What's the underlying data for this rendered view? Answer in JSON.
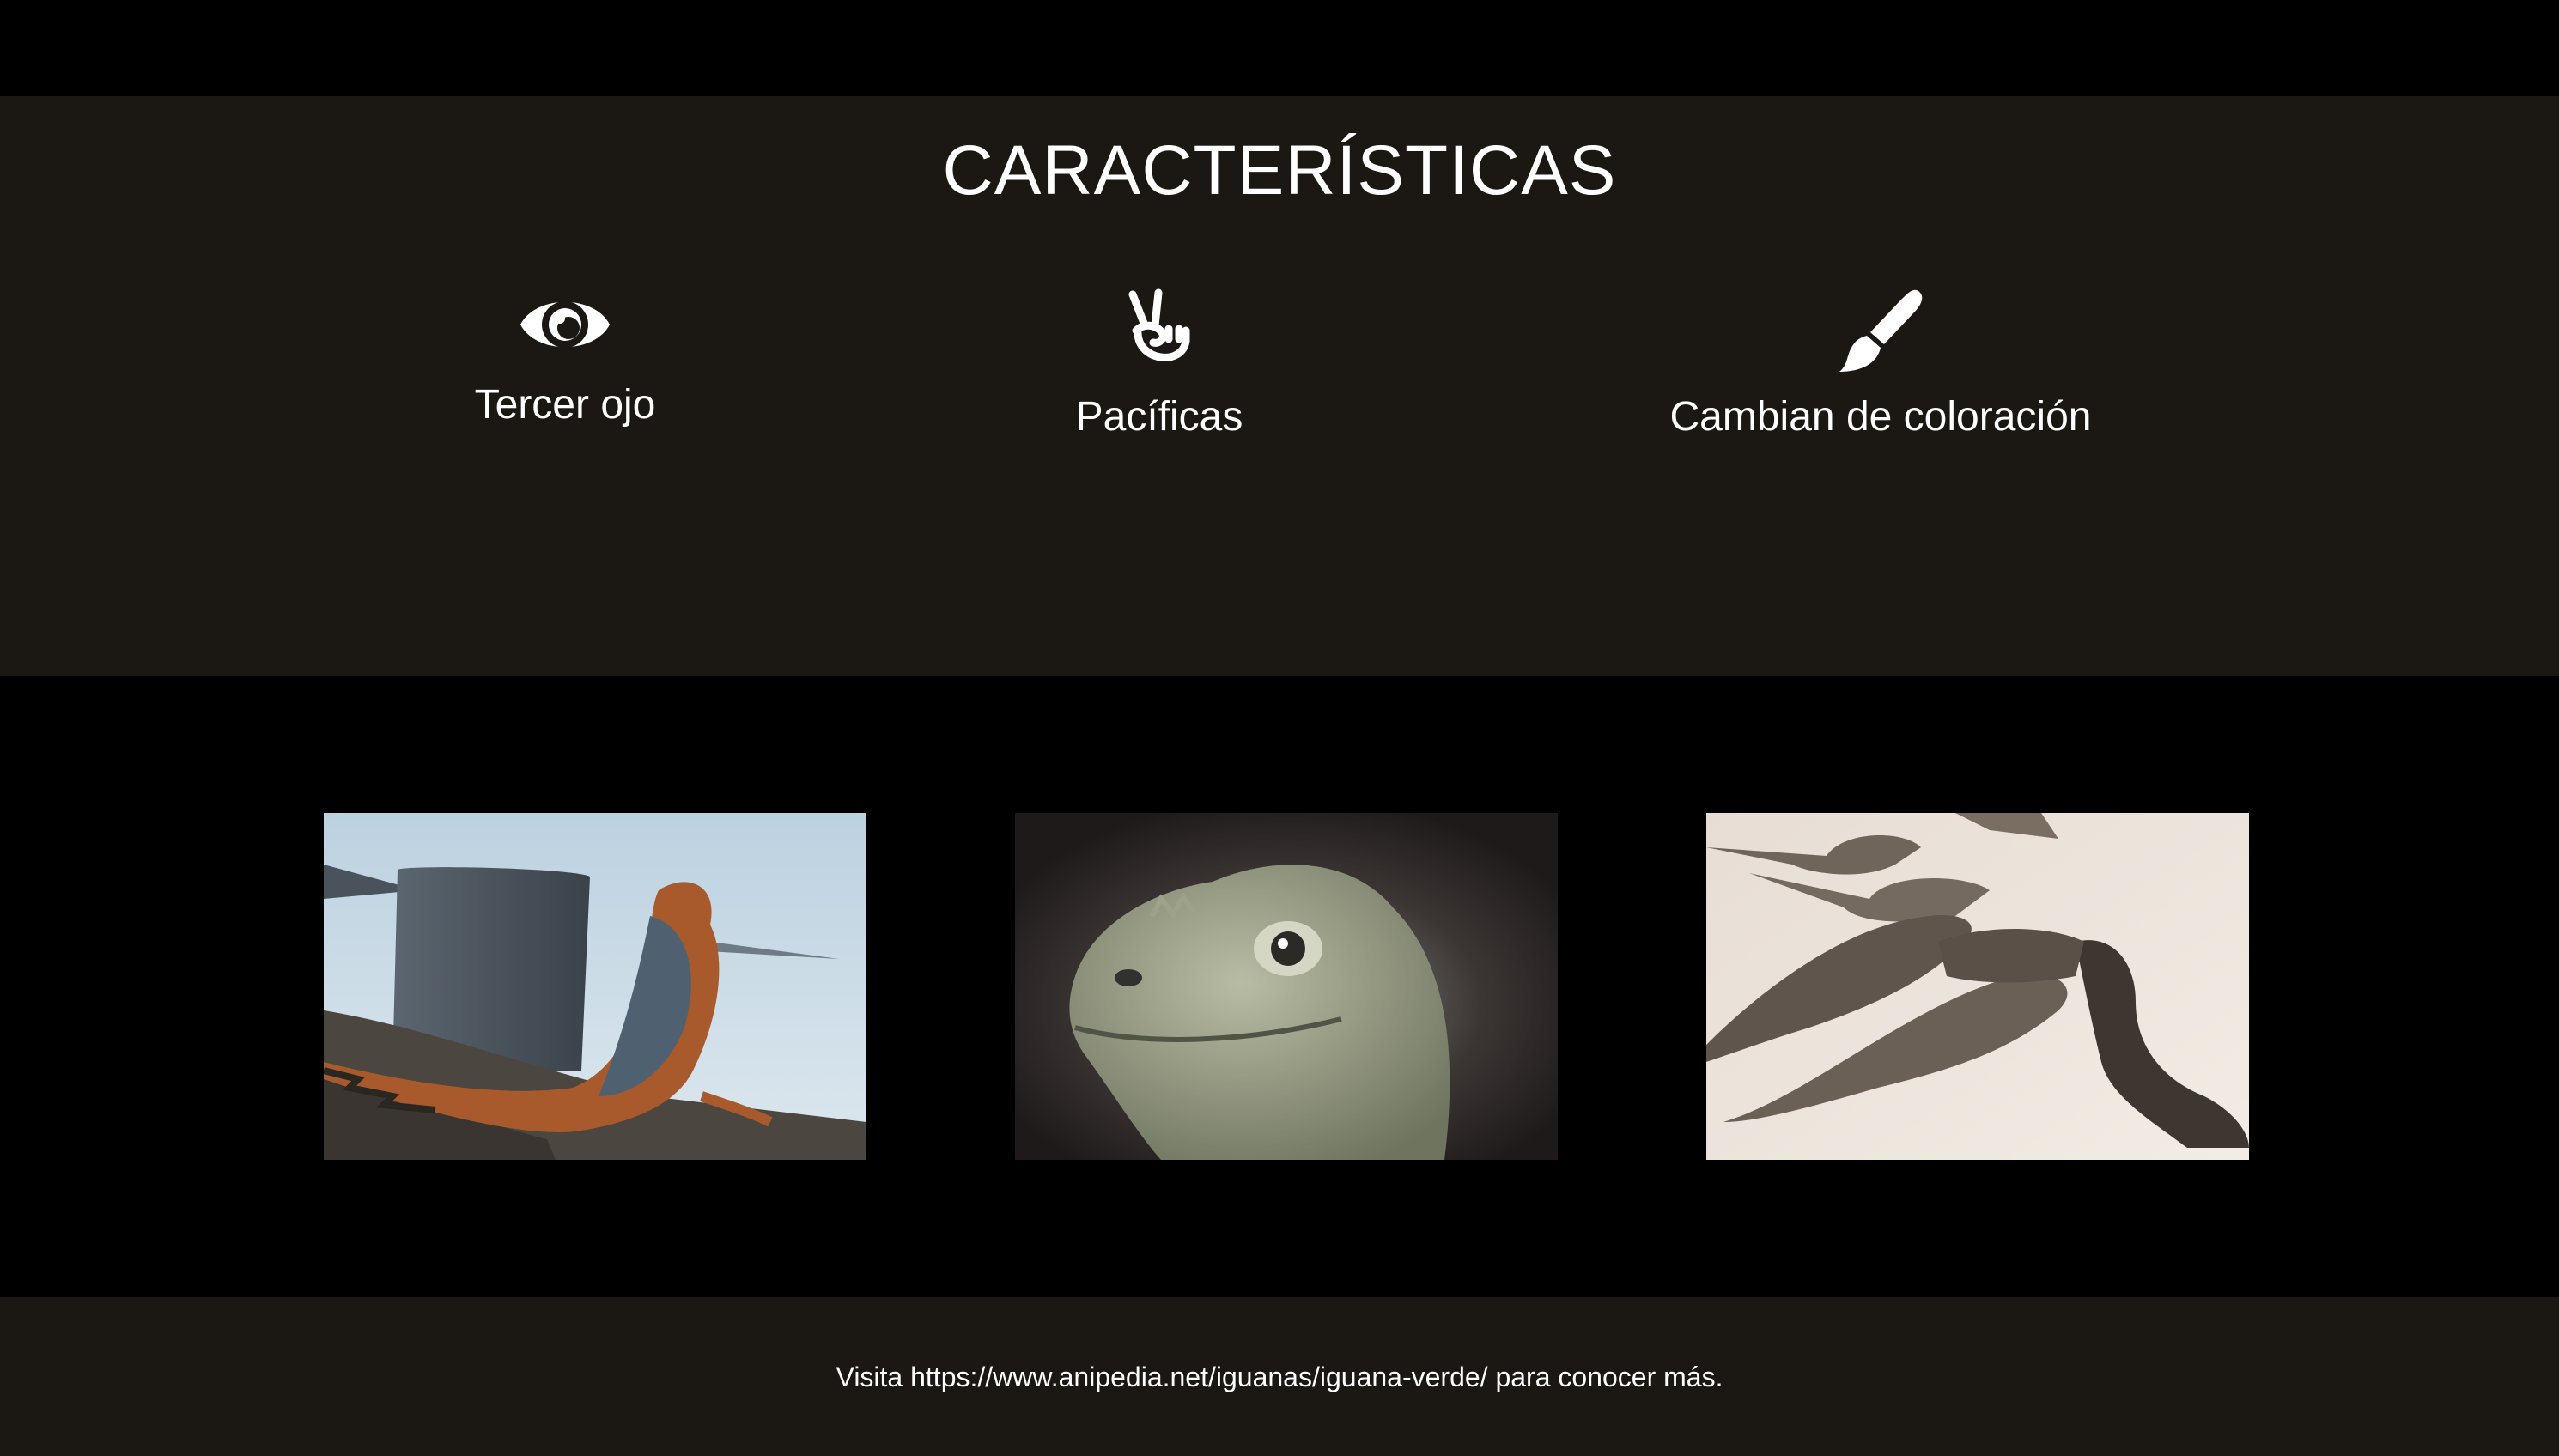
{
  "features": {
    "title": "CARACTERÍSTICAS",
    "items": [
      {
        "label": "Tercer ojo",
        "icon": "eye-icon"
      },
      {
        "label": "Pacíficas",
        "icon": "peace-hand-icon"
      },
      {
        "label": "Cambian de coloración",
        "icon": "paint-brush-icon"
      }
    ]
  },
  "gallery": {
    "photos": [
      {
        "subject": "iguana-on-shore-photo"
      },
      {
        "subject": "iguana-head-closeup-photo"
      },
      {
        "subject": "iguanas-on-sand-photo"
      }
    ]
  },
  "footer": {
    "text": "Visita https://www.anipedia.net/iguanas/iguana-verde/ para conocer más."
  },
  "colors": {
    "page_background": "#000000",
    "section_background": "#1b1813",
    "text": "#ffffff"
  }
}
